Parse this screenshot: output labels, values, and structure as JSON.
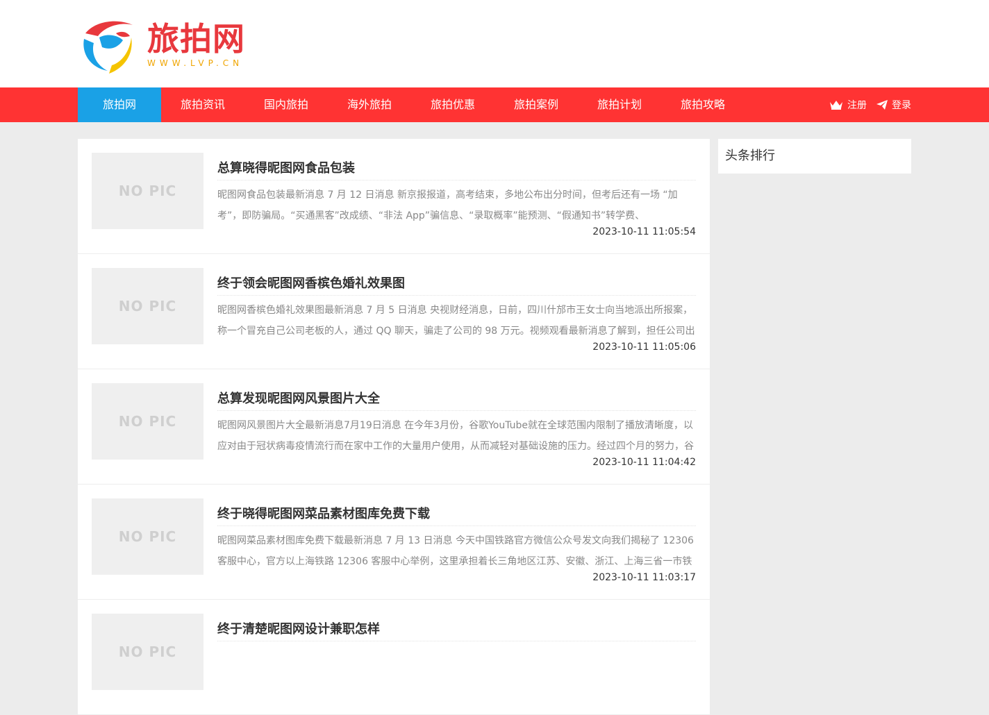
{
  "logo": {
    "name_cn": "旅拍网",
    "domain": "WWW.LVP.CN"
  },
  "nav": {
    "items": [
      "旅拍网",
      "旅拍资讯",
      "国内旅拍",
      "海外旅拍",
      "旅拍优惠",
      "旅拍案例",
      "旅拍计划",
      "旅拍攻略"
    ],
    "active_index": 0,
    "register": "注册",
    "login": "登录"
  },
  "posts": [
    {
      "thumb": "NO PIC",
      "title": "总算晓得昵图网食品包装",
      "desc": "昵图网食品包装最新消息 7 月 12 日消息 新京报报道，高考结束，多地公布出分时间，但考后还有一场 “加考”，即防骗局。“买通黑客”改成绩、“非法 App”骗信息、“录取概率”能预测、“假通知书”转学费、",
      "date": "2023-10-11 11:05:54"
    },
    {
      "thumb": "NO PIC",
      "title": "终于领会昵图网香槟色婚礼效果图",
      "desc": "昵图网香槟色婚礼效果图最新消息 7 月 5 日消息 央视财经消息，日前，四川什邡市王女士向当地派出所报案，称一个冒充自己公司老板的人，通过 QQ 聊天，骗走了公司的 98 万元。视频观看最新消息了解到，担任公司出",
      "date": "2023-10-11 11:05:06"
    },
    {
      "thumb": "NO PIC",
      "title": "总算发现昵图网风景图片大全",
      "desc": "昵图网风景图片大全最新消息7月19日消息 在今年3月份，谷歌YouTube就在全球范围内限制了播放清晰度，以应对由于冠状病毒疫情流行而在家中工作的大量用户使用，从而减轻对基础设施的压力。经过四个月的努力，谷",
      "date": "2023-10-11 11:04:42"
    },
    {
      "thumb": "NO PIC",
      "title": "终于晓得昵图网菜品素材图库免费下载",
      "desc": "昵图网菜品素材图库免费下载最新消息 7 月 13 日消息 今天中国铁路官方微信公众号发文向我们揭秘了 12306 客服中心，官方以上海铁路 12306 客服中心举例，这里承担着长三角地区江苏、安徽、浙江、上海三省一市铁",
      "date": "2023-10-11 11:03:17"
    },
    {
      "thumb": "NO PIC",
      "title": "终于清楚昵图网设计兼职怎样",
      "desc": "",
      "date": ""
    }
  ],
  "sidebar": {
    "title": "头条排行"
  },
  "colors": {
    "nav_bg": "#ff3333",
    "nav_active": "#1aa1e6",
    "logo_red": "#e8383d",
    "logo_gold": "#f0a500"
  }
}
